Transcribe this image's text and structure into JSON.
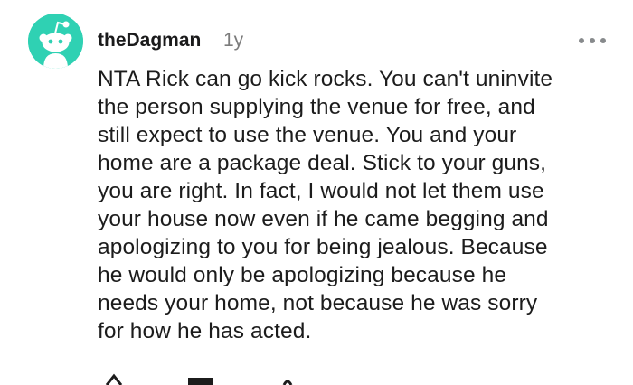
{
  "comment": {
    "author": "theDagman",
    "age": "1y",
    "lines": [
      "NTA Rick can go kick rocks. You can't uninvite",
      "the person supplying the venue for free, and",
      "still expect to use the venue. You and your",
      "home are a package deal. Stick to your guns,",
      "you are right. In fact, I would not let them use",
      "your house now even if he came begging and",
      "apologizing to you for being jealous. Because",
      "he would only be apologizing because he",
      "needs your home, not because he was sorry",
      "for how he has acted."
    ]
  },
  "icons": {
    "avatar": "snoo-avatar-icon",
    "more": "more-options-icon",
    "vote": "upvote-icon",
    "reply": "reply-icon",
    "award": "award-icon"
  },
  "colors": {
    "avatar_bg": "#2fd1b3",
    "muted": "#7c7c7c",
    "text": "#1c1c1c"
  }
}
